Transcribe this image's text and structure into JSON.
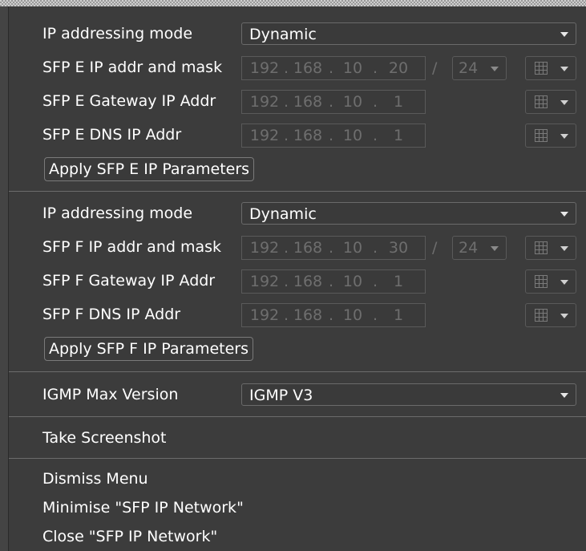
{
  "sfp_e": {
    "mode_label": "IP addressing mode",
    "mode_value": "Dynamic",
    "ip_label": "SFP E IP addr and mask",
    "ip": [
      "192",
      "168",
      "10",
      "20"
    ],
    "mask": "24",
    "gateway_label": "SFP E Gateway IP Addr",
    "gateway": [
      "192",
      "168",
      "10",
      "1"
    ],
    "dns_label": "SFP E DNS IP Addr",
    "dns": [
      "192",
      "168",
      "10",
      "1"
    ],
    "apply_label": "Apply SFP E IP Parameters"
  },
  "sfp_f": {
    "mode_label": "IP addressing mode",
    "mode_value": "Dynamic",
    "ip_label": "SFP F IP addr and mask",
    "ip": [
      "192",
      "168",
      "10",
      "30"
    ],
    "mask": "24",
    "gateway_label": "SFP F Gateway IP Addr",
    "gateway": [
      "192",
      "168",
      "10",
      "1"
    ],
    "dns_label": "SFP F DNS IP Addr",
    "dns": [
      "192",
      "168",
      "10",
      "1"
    ],
    "apply_label": "Apply SFP F IP Parameters"
  },
  "igmp": {
    "label": "IGMP Max Version",
    "value": "IGMP V3"
  },
  "menu": {
    "screenshot": "Take Screenshot",
    "dismiss": "Dismiss Menu",
    "minimise": "Minimise \"SFP IP Network\"",
    "close": "Close \"SFP IP Network\""
  },
  "separators": {
    "dot": ".",
    "slash": "/"
  },
  "icons": {
    "keypad": "keypad-grid-icon",
    "dropdown": "chevron-down-icon"
  }
}
